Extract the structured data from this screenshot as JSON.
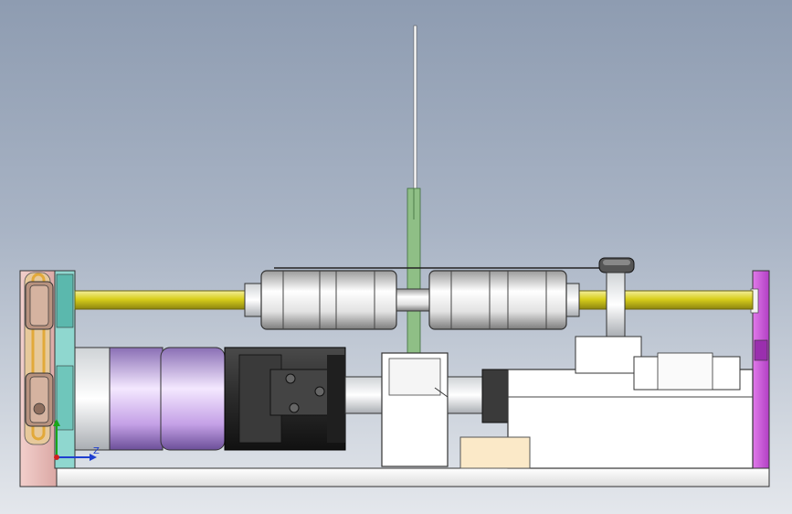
{
  "viewport": {
    "background_top": "#8e9cb1",
    "background_bottom": "#e4e7ec"
  },
  "triad": {
    "axis_z_label": "Z",
    "x_color": "#1f3fd0",
    "y_color": "#1aa51a",
    "z_color": "#d01f1f"
  },
  "colors": {
    "shaft": "#d8cf1c",
    "left_plate": "#e8b9b6",
    "teal_plate": "#8fd7cf",
    "right_plate": "#c94ad8",
    "belt": "#e2a93a",
    "motor_body": "#2c2c2c",
    "gearbox": "#c4a0e6",
    "sensor_strip": "#8fbf86"
  }
}
